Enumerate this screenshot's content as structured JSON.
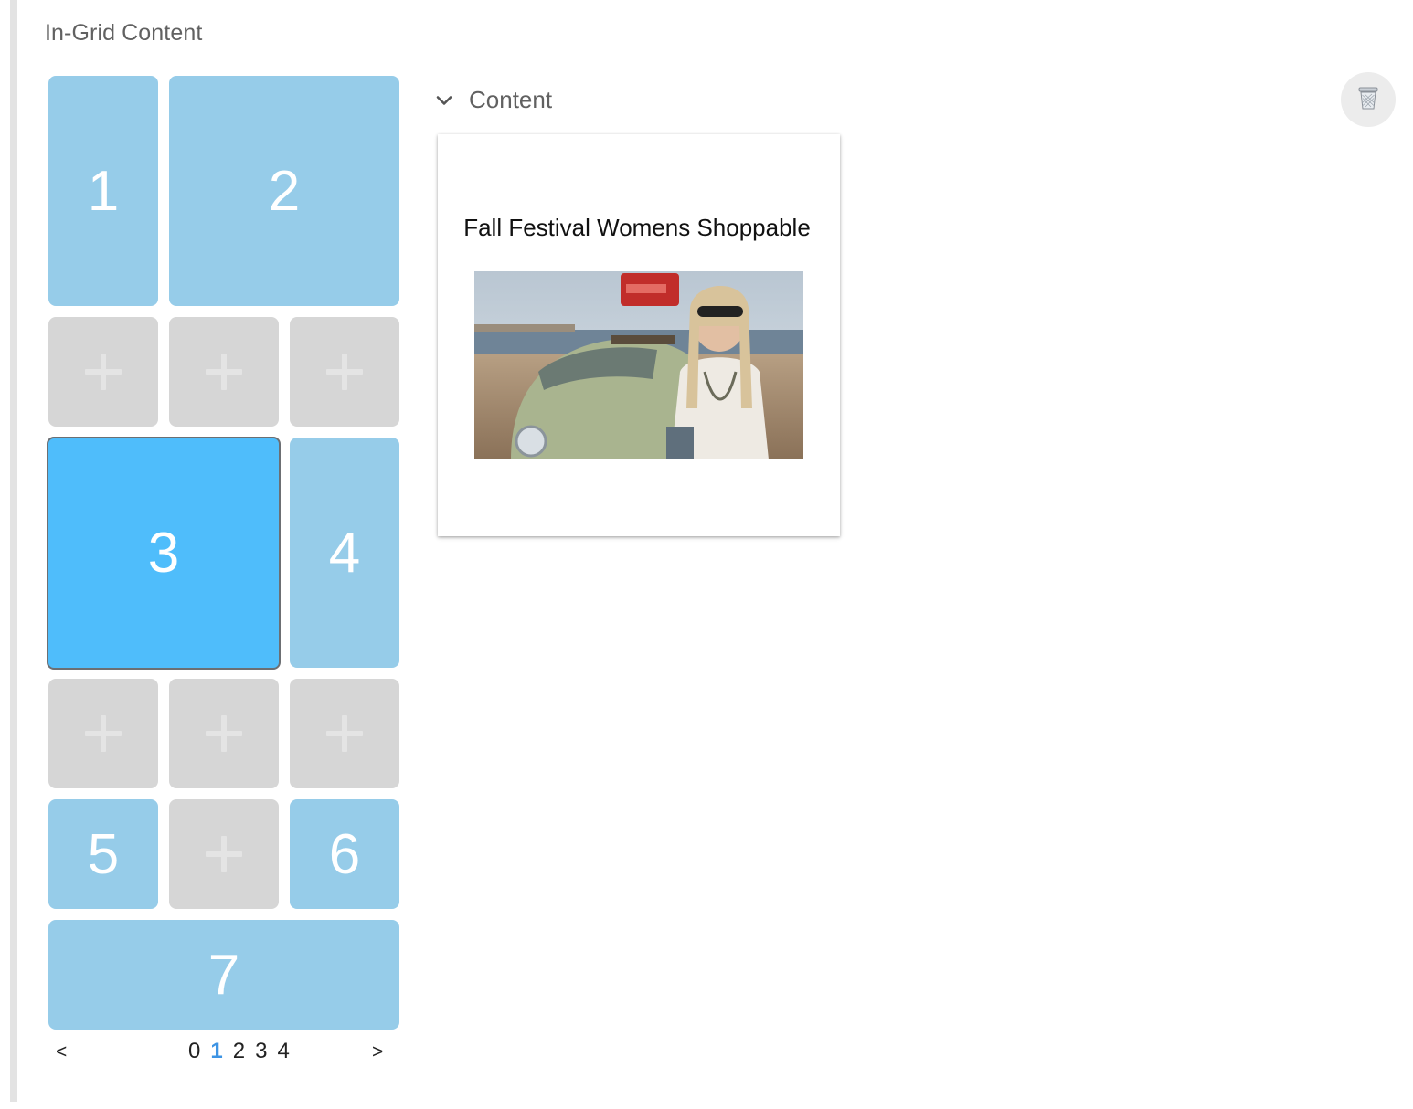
{
  "section": {
    "title": "In-Grid Content"
  },
  "grid": {
    "tiles": {
      "t1": "1",
      "t2": "2",
      "t3": "3",
      "t4": "4",
      "t5": "5",
      "t6": "6",
      "t7": "7"
    },
    "selected_tile": "3",
    "colors": {
      "filled": "#96cce9",
      "empty": "#d6d6d6",
      "selected": "#4fbdfb"
    }
  },
  "pager": {
    "prev": "<",
    "next": ">",
    "pages": [
      "0",
      "1",
      "2",
      "3",
      "4"
    ],
    "current_page": "1"
  },
  "content_panel": {
    "label": "Content",
    "card_title": "Fall Festival Womens Shoppable",
    "icons": {
      "collapse": "chevron-down-icon",
      "delete": "trash-icon"
    }
  }
}
